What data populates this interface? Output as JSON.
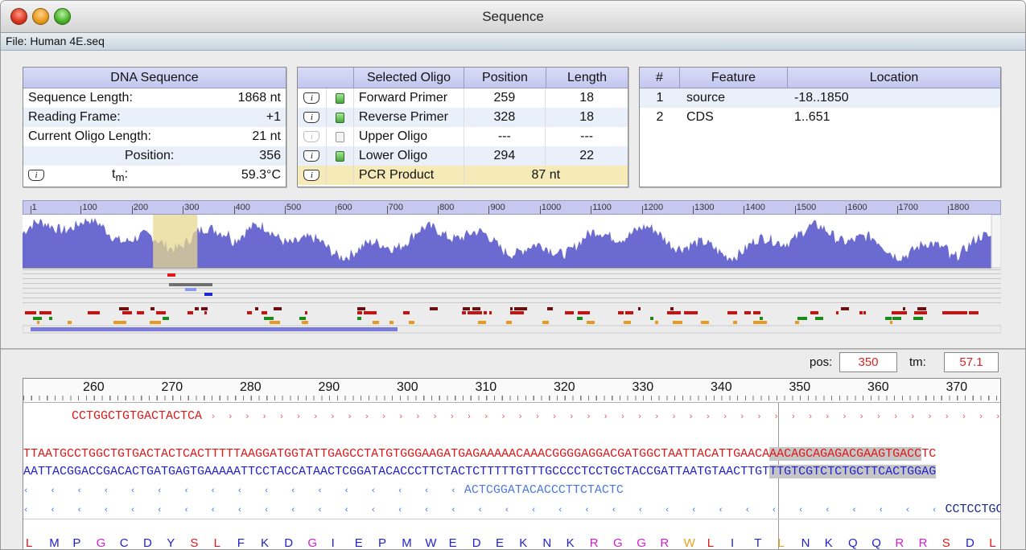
{
  "window": {
    "title": "Sequence"
  },
  "file": {
    "label": "File: Human 4E.seq"
  },
  "dna_panel": {
    "header": "DNA Sequence",
    "rows": [
      {
        "label": "Sequence Length:",
        "value": "1868 nt"
      },
      {
        "label": "Reading Frame:",
        "value": "+1"
      },
      {
        "label": "Current Oligo Length:",
        "value": "21 nt"
      },
      {
        "label": "Position:",
        "value": "356"
      },
      {
        "label": "t",
        "sub": "m",
        "colon": ":",
        "value": "59.3°C"
      }
    ]
  },
  "oligo_panel": {
    "headers": {
      "name": "Selected Oligo",
      "position": "Position",
      "length": "Length"
    },
    "rows": [
      {
        "name": "Forward Primer",
        "position": "259",
        "length": "18",
        "checked": true,
        "info_enabled": true
      },
      {
        "name": "Reverse Primer",
        "position": "328",
        "length": "18",
        "checked": true,
        "info_enabled": true
      },
      {
        "name": "Upper Oligo",
        "position": "---",
        "length": "---",
        "checked": false,
        "info_enabled": false
      },
      {
        "name": "Lower Oligo",
        "position": "294",
        "length": "22",
        "checked": true,
        "info_enabled": true
      }
    ],
    "pcr": {
      "name": "PCR Product",
      "value": "87 nt"
    }
  },
  "feature_panel": {
    "headers": {
      "num": "#",
      "feature": "Feature",
      "location": "Location"
    },
    "rows": [
      {
        "num": "1",
        "feature": "source",
        "location": "-18..1850"
      },
      {
        "num": "2",
        "feature": "CDS",
        "location": "1..651"
      }
    ]
  },
  "overview": {
    "ticks": [
      "1",
      "100",
      "200",
      "300",
      "400",
      "500",
      "600",
      "700",
      "800",
      "900",
      "1000",
      "1100",
      "1200",
      "1300",
      "1400",
      "1500",
      "1600",
      "1700",
      "1800"
    ],
    "highlight_range": [
      259,
      346
    ],
    "colors": {
      "profile": "#6a6ad0",
      "highlight": "#e8d890",
      "bar": "#7a7ad8"
    }
  },
  "readout": {
    "pos_label": "pos:",
    "pos_value": "350",
    "tm_label": "tm:",
    "tm_value": "57.1"
  },
  "sequence": {
    "ruler": [
      "260",
      "270",
      "280",
      "290",
      "300",
      "310",
      "320",
      "330",
      "340",
      "350",
      "360",
      "370"
    ],
    "forward_primer": "CCTGGCTGTGACTACTCA",
    "top_strand_a": "TTAATGCCTGGCTGTGACTACTCACTTTTTAAGGATGGTATTGAGCCTATGTGGGAAGATGAGAAAAACAAACGGGGAGGACGATGGCTAATTACATTGAACA",
    "top_strand_b": "AACAGCAGAGACGAAGTGACC",
    "top_strand_c": "TC",
    "bottom_strand_a": "AATTACGGACCGACACTGATGAGTGAAAAATTCCTACCATAACTCGGATACACCCTTCTACTCTTTTTGTTTGCCCCTCCTGCTACCGATTAATGTAACTTGT",
    "bottom_strand_b": "TTGTCGTCTCTGCTTCACTGGAG",
    "lower_oligo": "ACTCGGATACACCCTTCTACTC",
    "reverse_primer": "CCTCCTGCTACCGATTAA",
    "amino_acids": [
      "L",
      "M",
      "P",
      "G",
      "C",
      "D",
      "Y",
      "S",
      "L",
      "F",
      "K",
      "D",
      "G",
      "I",
      "E",
      "P",
      "M",
      "W",
      "E",
      "D",
      "E",
      "K",
      "N",
      "K",
      "R",
      "G",
      "G",
      "R",
      "W",
      "L",
      "I",
      "T",
      "L",
      "N",
      "K",
      "Q",
      "Q",
      "R",
      "R",
      "S",
      "D",
      "L"
    ]
  }
}
